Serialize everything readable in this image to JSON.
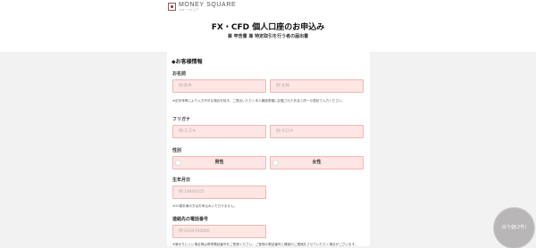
{
  "header": {
    "logo_name": "MONEY SQUARE",
    "logo_sub": "マネースクエア",
    "title": "FX・CFD 個人口座のお申込み",
    "subtitle": "兼 申告書 兼 特定取引を行う者の届出書"
  },
  "form": {
    "section_title": "◆お客様情報",
    "name": {
      "label": "お名前",
      "last_placeholder": "例:鈴木",
      "first_placeholder": "例:太郎",
      "note": "※旧字体等により入力不可な場合を除き、ご提出いただく本人確認書類に記載された氏名と同一の表記で入力ください。"
    },
    "kana": {
      "label": "フリガナ",
      "last_placeholder": "例:スズキ",
      "first_placeholder": "例:タロウ"
    },
    "gender": {
      "label": "性別",
      "options": [
        "男性",
        "女性"
      ]
    },
    "birthdate": {
      "label": "生年月日",
      "placeholder": "例:19800105",
      "note": "※20歳未満の方はお申込みいただけません。"
    },
    "phone": {
      "label": "連絡先の電話番号",
      "placeholder": "例:0334700000",
      "note": "※繋がりにくい場合等は携帯電話番号をご登録ください。ご登録の電話番号に確認のご連絡をさせていただく場合がございます。"
    }
  },
  "floating_button": {
    "label": "戻り値(2件)"
  }
}
